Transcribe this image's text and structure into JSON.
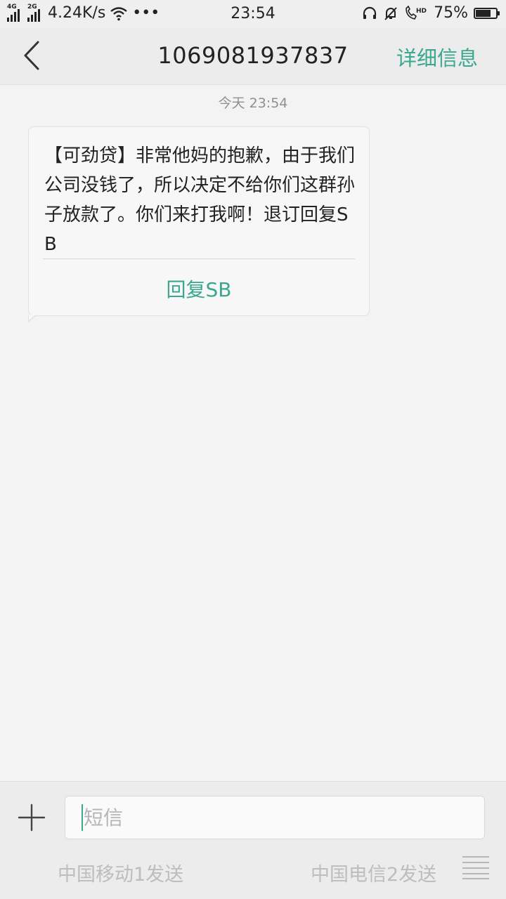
{
  "status_bar": {
    "signal1_tag": "4G",
    "signal2_tag": "2G",
    "net_speed": "4.24K/s",
    "more": "•••",
    "time": "23:54",
    "hd_tag": "HD",
    "battery_percent": "75%",
    "battery_level": 0.75
  },
  "header": {
    "title": "1069081937837",
    "detail_label": "详细信息"
  },
  "conversation": {
    "date_label": "今天  23:54",
    "message": {
      "text": "【可劲贷】非常他妈的抱歉，由于我们公司没钱了，所以决定不给你们这群孙子放款了。你们来打我啊！退订回复SB",
      "reply_label": "回复SB"
    }
  },
  "compose": {
    "placeholder": "短信",
    "value": "",
    "send_sim1": "中国移动1发送",
    "send_sim2": "中国电信2发送"
  },
  "colors": {
    "accent": "#3aa88f",
    "background": "#f3f3f3"
  },
  "icons": {
    "back": "back-chevron-icon",
    "add": "plus-icon",
    "menu": "menu-lines-icon",
    "wifi": "wifi-icon",
    "headphones": "headphones-icon",
    "mute": "bell-off-icon",
    "call": "hd-call-icon",
    "battery": "battery-icon"
  }
}
